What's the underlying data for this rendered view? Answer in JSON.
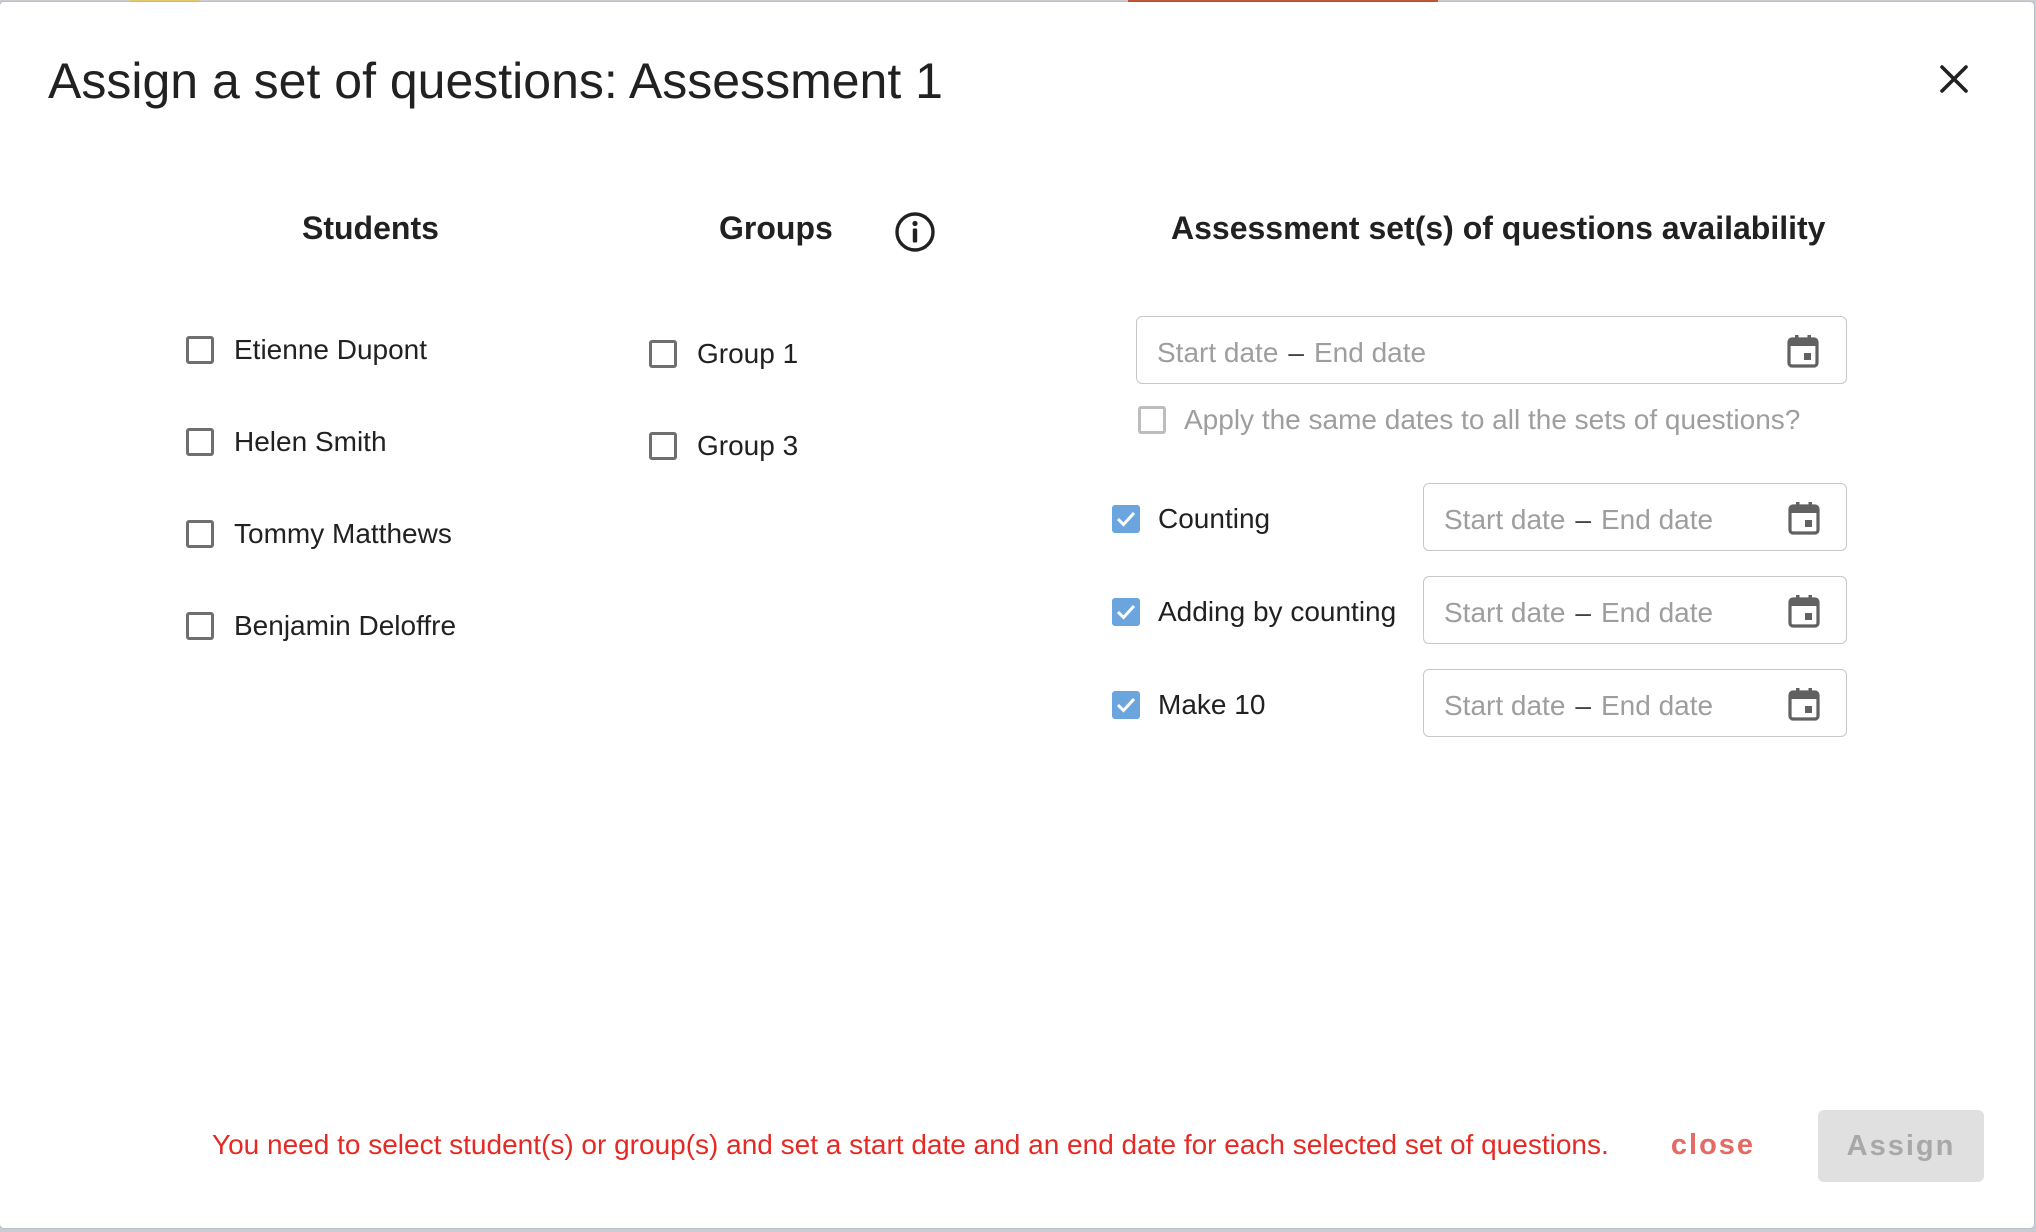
{
  "dialog": {
    "title": "Assign a set of questions: Assessment 1"
  },
  "students": {
    "heading": "Students",
    "items": [
      {
        "label": "Etienne Dupont",
        "checked": false
      },
      {
        "label": "Helen Smith",
        "checked": false
      },
      {
        "label": "Tommy Matthews",
        "checked": false
      },
      {
        "label": "Benjamin Deloffre",
        "checked": false
      }
    ]
  },
  "groups": {
    "heading": "Groups",
    "info_icon": "info-circle-icon",
    "items": [
      {
        "label": "Group 1",
        "checked": false
      },
      {
        "label": "Group 3",
        "checked": false
      }
    ]
  },
  "availability": {
    "heading": "Assessment set(s) of questions availability",
    "global_range": {
      "start_placeholder": "Start date",
      "separator": "–",
      "end_placeholder": "End date"
    },
    "apply_same_dates": {
      "label": "Apply the same dates to all the sets of questions?",
      "checked": false,
      "disabled": true
    },
    "sets": [
      {
        "label": "Counting",
        "checked": true,
        "start_placeholder": "Start date",
        "separator": "–",
        "end_placeholder": "End date"
      },
      {
        "label": "Adding by counting",
        "checked": true,
        "start_placeholder": "Start date",
        "separator": "–",
        "end_placeholder": "End date"
      },
      {
        "label": "Make 10",
        "checked": true,
        "start_placeholder": "Start date",
        "separator": "–",
        "end_placeholder": "End date"
      }
    ]
  },
  "footer": {
    "warning": "You need to select student(s) or group(s) and set a start date and an end date for each selected set of questions.",
    "close_label": "close",
    "assign_label": "Assign"
  },
  "colors": {
    "accent_checked": "#6aa5dd",
    "warning_text": "#e52a25",
    "close_text": "#e56a63",
    "assign_disabled_bg": "#e0e0e0"
  },
  "icons": {
    "close": "close-icon",
    "calendar": "calendar-icon",
    "check": "check-icon"
  }
}
